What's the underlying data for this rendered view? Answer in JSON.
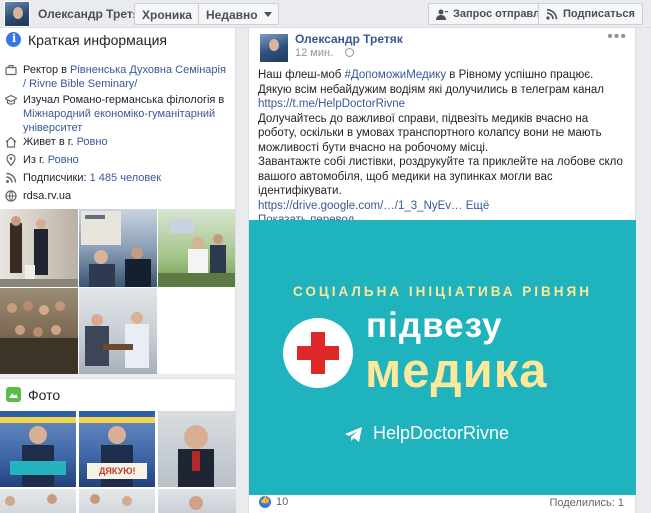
{
  "header": {
    "profile_name": "Олександр Третяк",
    "timeline_label": "Хроника",
    "recent_label": "Недавно",
    "request_sent_label": "Запрос отправлен",
    "subscribe_label": "Подписаться"
  },
  "intro": {
    "title": "Краткая информация",
    "rows": [
      {
        "prefix": "Ректор в ",
        "link": "Рівненська Духовна Семінарія / Rivne Bible Seminary/",
        "icon": "briefcase-icon"
      },
      {
        "prefix": "Изучал Романо-германська філологія в ",
        "link": "Міжнародний економіко-гуманітарний університет",
        "icon": "graduation-cap-icon"
      },
      {
        "prefix": "Живет в г. ",
        "link": "Ровно",
        "icon": "home-icon"
      },
      {
        "prefix": "Из г. ",
        "link": "Ровно",
        "icon": "location-pin-icon"
      },
      {
        "prefix": "Подписчики: ",
        "link": "1 485 человек",
        "icon": "rss-icon"
      },
      {
        "prefix": "",
        "link": "rdsa.rv.ua",
        "icon": "globe-icon"
      }
    ]
  },
  "photos_section": {
    "title": "Фото",
    "thumb_text_1": "ДЯКУЮ!"
  },
  "post": {
    "author": "Олександр Третяк",
    "time": "12 мин.",
    "para1_a": "Наш флеш-моб ",
    "para1_tag": "#ДопоможиМедику",
    "para1_b": " в Рівному успішно працює. Дякую всім небайдужим водіям які долучились в телеграм канал",
    "para1_link": "https://t.me/HelpDoctorRivne",
    "para2": "Долучайтесь до важливої справи, підвезіть медиків вчасно на роботу, оскільки в умовах транспортного колапсу вони не мають можливості бути вчасно на робочому місці.",
    "para3": "Завантажте собі листівки, роздрукуйте та приклейте на лобове скло вашого автомобіля, щоб медики на зупинках могли вас ідентифікувати.",
    "drive_link": "https://drive.google.com/…/1_3_NyEv…",
    "more_label": "Ещё",
    "translate_label": "Показать перевод",
    "banner": {
      "tagline": "СОЦІАЛЬНА ІНІЦІАТИВА РІВНЯН",
      "word1": "підвезу",
      "word2": "медика",
      "url": "HelpDoctorRivne"
    },
    "reactions_count": "10",
    "shares_label": "Поделились: 1"
  },
  "colors": {
    "accent": "#385898",
    "banner_bg": "#1fb3bd",
    "banner_yellow": "#fde79a",
    "cross_red": "#e02727"
  }
}
